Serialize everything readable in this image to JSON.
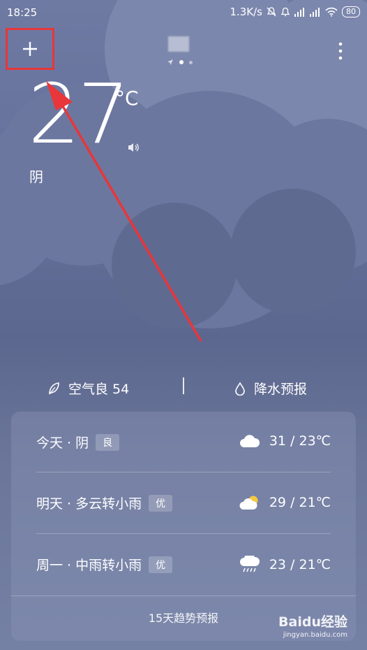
{
  "status_bar": {
    "time": "18:25",
    "network_speed": "1.3K/s",
    "battery": "80",
    "icons": [
      "mute-bell-icon",
      "alarm-icon",
      "signal-icon",
      "signal-icon",
      "wifi-icon",
      "battery-icon"
    ]
  },
  "header": {
    "add_icon": "plus-icon",
    "menu_icon": "more-vertical-icon",
    "page_indicator": {
      "pages": 2,
      "active": 0,
      "location_icon": "location-arrow-icon"
    }
  },
  "current": {
    "temperature": "27",
    "unit": "°C",
    "condition": "阴",
    "speaker_icon": "speaker-icon"
  },
  "air_quality": {
    "icon": "leaf-icon",
    "label": "空气良 54"
  },
  "precipitation": {
    "icon": "water-drop-icon",
    "label": "降水预报"
  },
  "forecast": [
    {
      "day": "今天 · 阴",
      "aqi": "良",
      "icon": "cloud-icon",
      "temp": "31 / 23℃"
    },
    {
      "day": "明天 · 多云转小雨",
      "aqi": "优",
      "icon": "partly-cloudy-icon",
      "temp": "29 / 21℃"
    },
    {
      "day": "周一 · 中雨转小雨",
      "aqi": "优",
      "icon": "rain-icon",
      "temp": "23 / 21℃"
    }
  ],
  "trend_button": "15天趋势预报",
  "watermark": {
    "logo": "Baidu经验",
    "url": "jingyan.baidu.com"
  },
  "colors": {
    "highlight": "#e8363a",
    "sun": "#f5c842"
  }
}
